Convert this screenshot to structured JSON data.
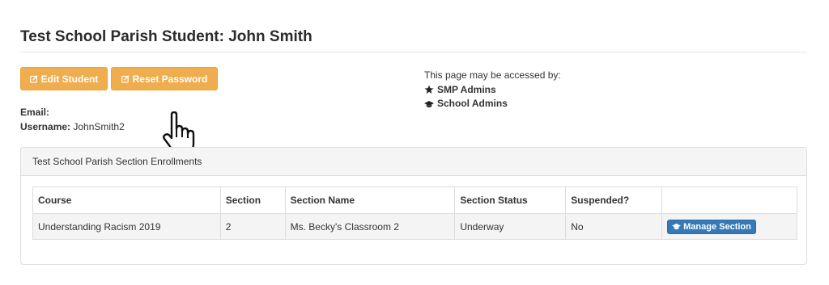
{
  "page": {
    "title": "Test School Parish Student: John Smith"
  },
  "actions": {
    "edit_label": "Edit Student",
    "reset_label": "Reset Password"
  },
  "access": {
    "intro": "This page may be accessed by:",
    "roles": [
      {
        "label": "SMP Admins",
        "icon": "star-icon"
      },
      {
        "label": "School Admins",
        "icon": "graduation-cap-icon"
      }
    ]
  },
  "student": {
    "email_label": "Email:",
    "email_value": "",
    "username_label": "Username:",
    "username_value": "JohnSmith2"
  },
  "enrollments": {
    "heading": "Test School Parish Section Enrollments",
    "columns": [
      "Course",
      "Section",
      "Section Name",
      "Section Status",
      "Suspended?",
      ""
    ],
    "rows": [
      {
        "course": "Understanding Racism 2019",
        "section": "2",
        "section_name": "Ms. Becky's Classroom 2",
        "status": "Underway",
        "suspended": "No",
        "action_label": "Manage Section"
      }
    ]
  },
  "colors": {
    "warning": "#f0ad4e",
    "primary": "#337ab7"
  }
}
